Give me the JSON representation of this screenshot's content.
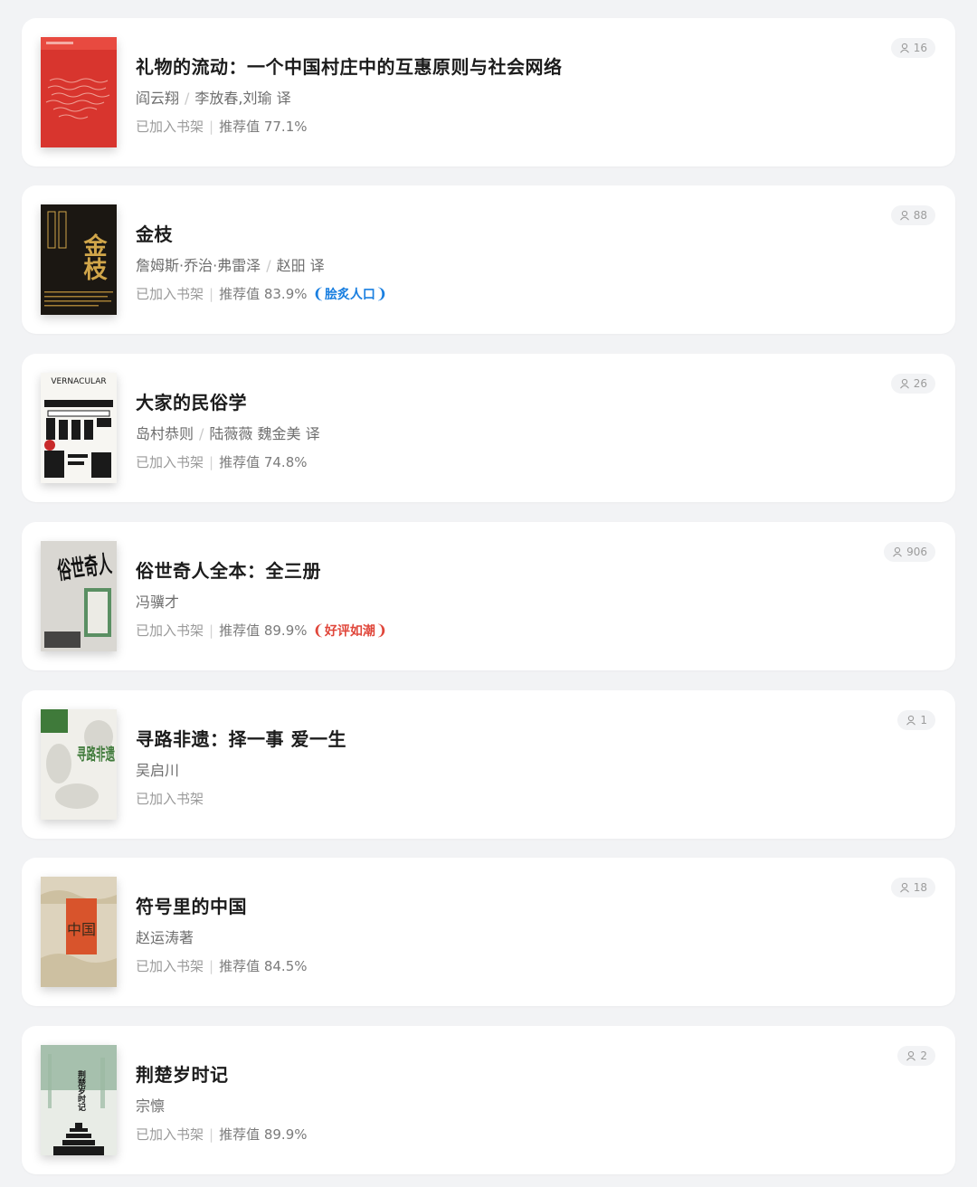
{
  "books": [
    {
      "title": "礼物的流动：一个中国村庄中的互惠原则与社会网络",
      "author": "阎云翔",
      "translator": "李放春,刘瑜 译",
      "status": "已加入书架",
      "recommend": "推荐值 77.1%",
      "badge": "",
      "readers": "16",
      "cover_text": ""
    },
    {
      "title": "金枝",
      "author": "詹姆斯·乔治·弗雷泽",
      "translator": "赵昍 译",
      "status": "已加入书架",
      "recommend": "推荐值 83.9%",
      "badge": "脍炙人口",
      "badge_color": "#1a7fe0",
      "readers": "88",
      "cover_text": "金枝"
    },
    {
      "title": "大家的民俗学",
      "author": "岛村恭则",
      "translator": "陆薇薇 魏金美 译",
      "status": "已加入书架",
      "recommend": "推荐值 74.8%",
      "badge": "",
      "readers": "26",
      "cover_text": "VERNACULAR"
    },
    {
      "title": "俗世奇人全本：全三册",
      "author": "冯骥才",
      "translator": "",
      "status": "已加入书架",
      "recommend": "推荐值 89.9%",
      "badge": "好评如潮",
      "badge_color": "#e0463a",
      "readers": "906",
      "cover_text": "俗世奇人"
    },
    {
      "title": "寻路非遗：择一事 爱一生",
      "author": "吴启川",
      "translator": "",
      "status": "已加入书架",
      "recommend": "",
      "badge": "",
      "readers": "1",
      "cover_text": "寻路非遗"
    },
    {
      "title": "符号里的中国",
      "author": "赵运涛著",
      "translator": "",
      "status": "已加入书架",
      "recommend": "推荐值 84.5%",
      "badge": "",
      "readers": "18",
      "cover_text": "中国"
    },
    {
      "title": "荆楚岁时记",
      "author": "宗懔",
      "translator": "",
      "status": "已加入书架",
      "recommend": "推荐值 89.9%",
      "badge": "",
      "readers": "2",
      "cover_text": "荆楚岁时记"
    }
  ],
  "icons": {
    "readers": "user-icon",
    "badge": "laurel-icon"
  },
  "colors": {
    "badge_blue": "#1a7fe0",
    "badge_red": "#e0463a"
  }
}
